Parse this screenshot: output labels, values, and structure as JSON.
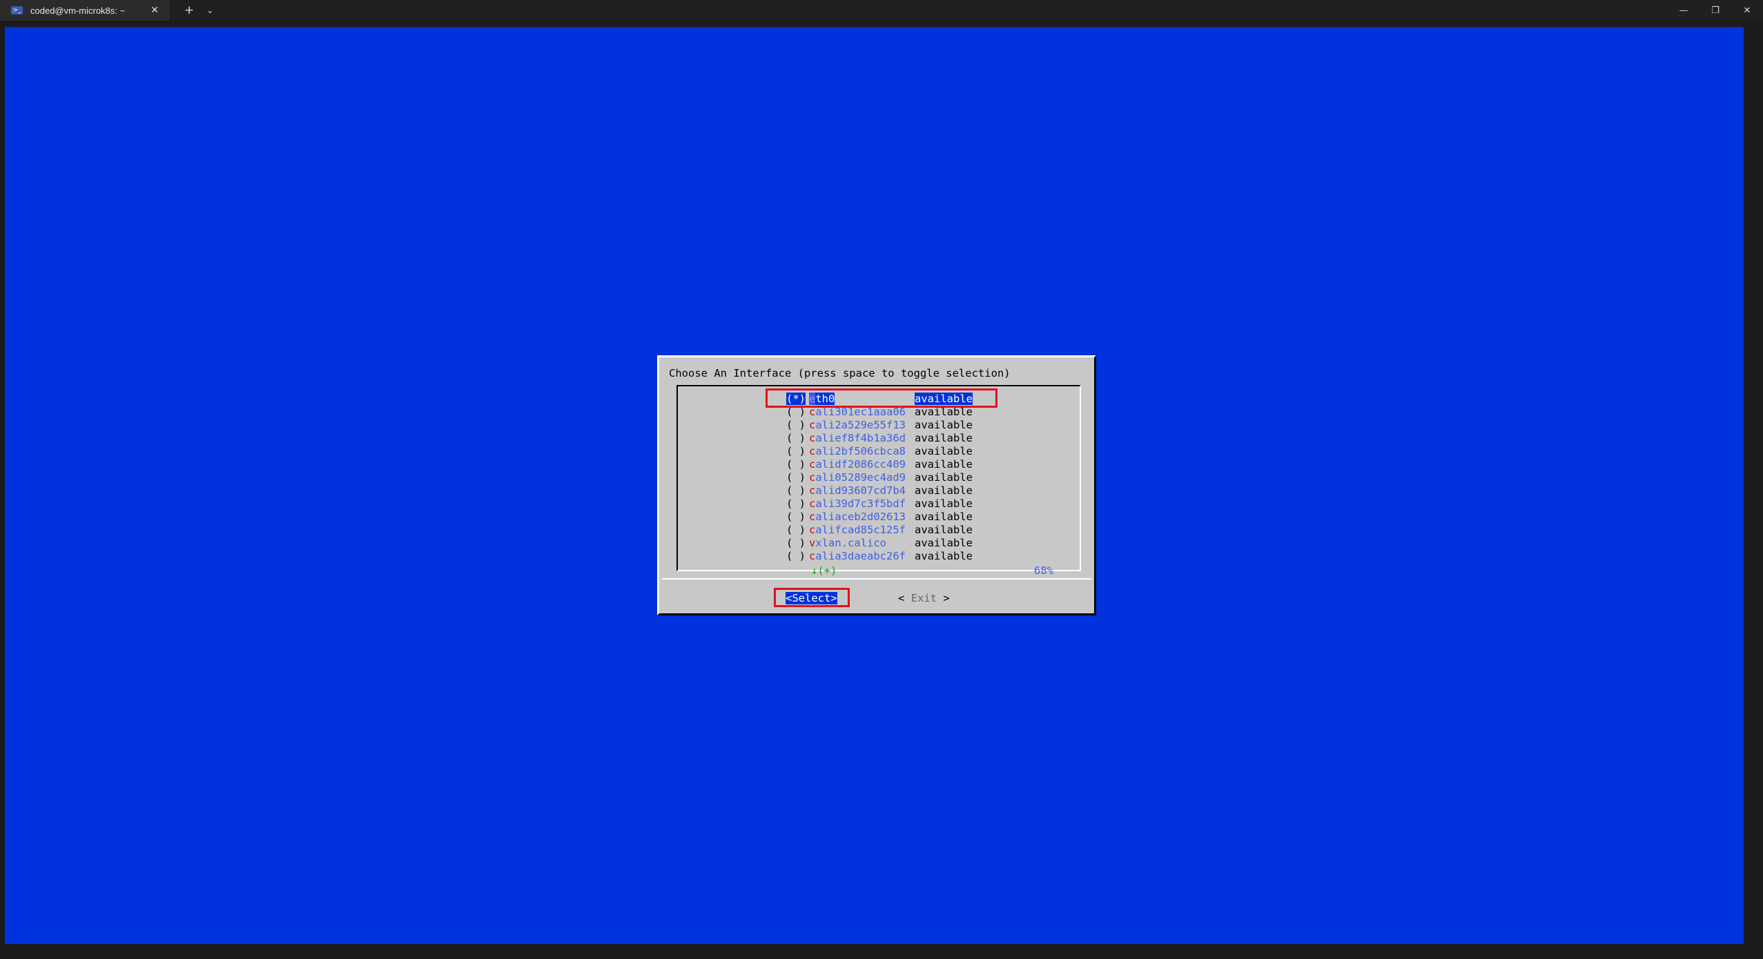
{
  "window": {
    "tab_title": "coded@vm-microk8s: ~",
    "tab_icon": "terminal-icon",
    "new_tab_glyph": "+",
    "tab_menu_glyph": "⌄",
    "close_glyph": "✕",
    "minimize_glyph": "—",
    "restore_glyph": "❐",
    "window_close_glyph": "✕"
  },
  "colors": {
    "terminal_bg": "#0033dd",
    "dialog_bg": "#c8c8c8",
    "selection": "#0033dd",
    "hotkey": "#c01010",
    "item_text": "#3f5fe0",
    "annotation_box": "#e0121b"
  },
  "dialog": {
    "prompt": "Choose An Interface (press space to toggle selection)",
    "more_indicator": "↓(+)",
    "scroll_percent": "68%",
    "select_button": "<Select>",
    "exit_button_left": "<",
    "exit_button_label": "Exit",
    "exit_button_right": ">"
  },
  "interfaces": [
    {
      "radio": "(*)",
      "hot": "e",
      "rest": "th0",
      "status": "available",
      "selected": true
    },
    {
      "radio": "( )",
      "hot": "c",
      "rest": "ali301ec1aaa06",
      "status": "available"
    },
    {
      "radio": "( )",
      "hot": "c",
      "rest": "ali2a529e55f13",
      "status": "available"
    },
    {
      "radio": "( )",
      "hot": "c",
      "rest": "alief8f4b1a36d",
      "status": "available"
    },
    {
      "radio": "( )",
      "hot": "c",
      "rest": "ali2bf506cbca8",
      "status": "available"
    },
    {
      "radio": "( )",
      "hot": "c",
      "rest": "alidf2086cc409",
      "status": "available"
    },
    {
      "radio": "( )",
      "hot": "c",
      "rest": "ali05289ec4ad9",
      "status": "available"
    },
    {
      "radio": "( )",
      "hot": "c",
      "rest": "alid93607cd7b4",
      "status": "available"
    },
    {
      "radio": "( )",
      "hot": "c",
      "rest": "ali39d7c3f5bdf",
      "status": "available"
    },
    {
      "radio": "( )",
      "hot": "c",
      "rest": "aliaceb2d02613",
      "status": "available"
    },
    {
      "radio": "( )",
      "hot": "c",
      "rest": "alifcad85c125f",
      "status": "available"
    },
    {
      "radio": "( )",
      "hot": "v",
      "rest": "xlan.calico",
      "status": "available"
    },
    {
      "radio": "( )",
      "hot": "c",
      "rest": "alia3daeabc26f",
      "status": "available"
    }
  ]
}
